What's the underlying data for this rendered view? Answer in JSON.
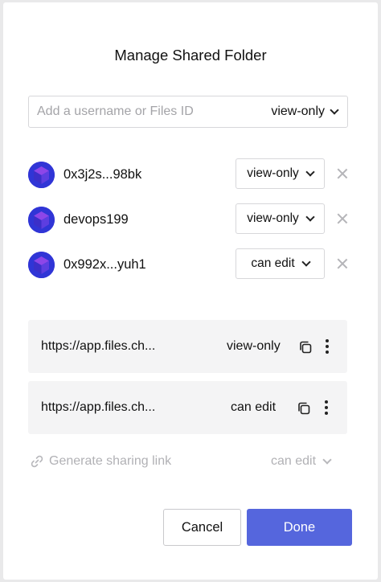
{
  "dialog": {
    "title": "Manage Shared Folder"
  },
  "add_user": {
    "placeholder": "Add a username or Files ID",
    "value": "",
    "permission": "view-only"
  },
  "members": [
    {
      "name": "0x3j2s...98bk",
      "permission": "view-only"
    },
    {
      "name": "devops199",
      "permission": "view-only"
    },
    {
      "name": "0x992x...yuh1",
      "permission": "can edit"
    }
  ],
  "links": [
    {
      "url": "https://app.files.ch...",
      "permission": "view-only"
    },
    {
      "url": "https://app.files.ch...",
      "permission": "can edit"
    }
  ],
  "generate": {
    "label": "Generate sharing link",
    "permission": "can edit"
  },
  "actions": {
    "cancel_label": "Cancel",
    "done_label": "Done"
  },
  "colors": {
    "primary": "#5566dd",
    "avatar": "#3338d8",
    "muted_text": "#b1b1b5",
    "card_bg": "#f4f4f5"
  },
  "icons": {
    "avatar": "cube-avatar-icon",
    "dropdown": "chevron-down-icon",
    "remove": "close-icon",
    "copy": "copy-icon",
    "more": "kebab-menu-icon",
    "link": "link-icon"
  }
}
